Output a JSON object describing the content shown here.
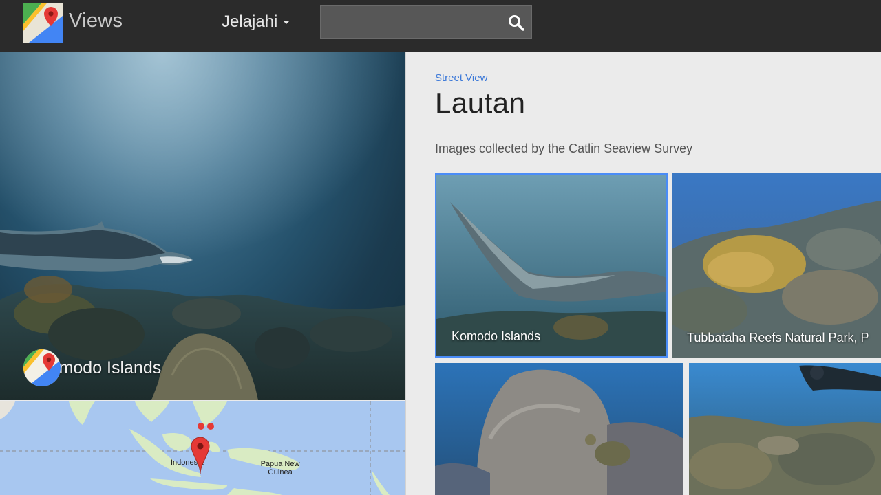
{
  "header": {
    "app_title": "Views",
    "explore_menu_label": "Jelajahi",
    "search": {
      "value": "",
      "placeholder": ""
    }
  },
  "hero": {
    "location_label": "Komodo Islands"
  },
  "map": {
    "labels": [
      "Indonesia",
      "Papua New Guinea"
    ]
  },
  "collection": {
    "breadcrumb": "Street View",
    "title": "Lautan",
    "description": "Images collected by the Catlin Seaview Survey",
    "items": [
      {
        "label": "Komodo Islands",
        "selected": true
      },
      {
        "label": "Tubbataha Reefs Natural Park, P",
        "selected": false
      },
      {
        "label": "",
        "selected": false
      },
      {
        "label": "",
        "selected": false
      }
    ]
  },
  "colors": {
    "topbar": "#2b2b2b",
    "accent_link": "#3b78d8",
    "selected_border": "#4a8cf7",
    "map_water": "#a8c7f0",
    "map_pin": "#e53935"
  },
  "icons": {
    "logo": "maps-logo-icon",
    "search": "search-icon",
    "dropdown": "caret-down-icon",
    "map_marker": "map-marker-icon"
  }
}
